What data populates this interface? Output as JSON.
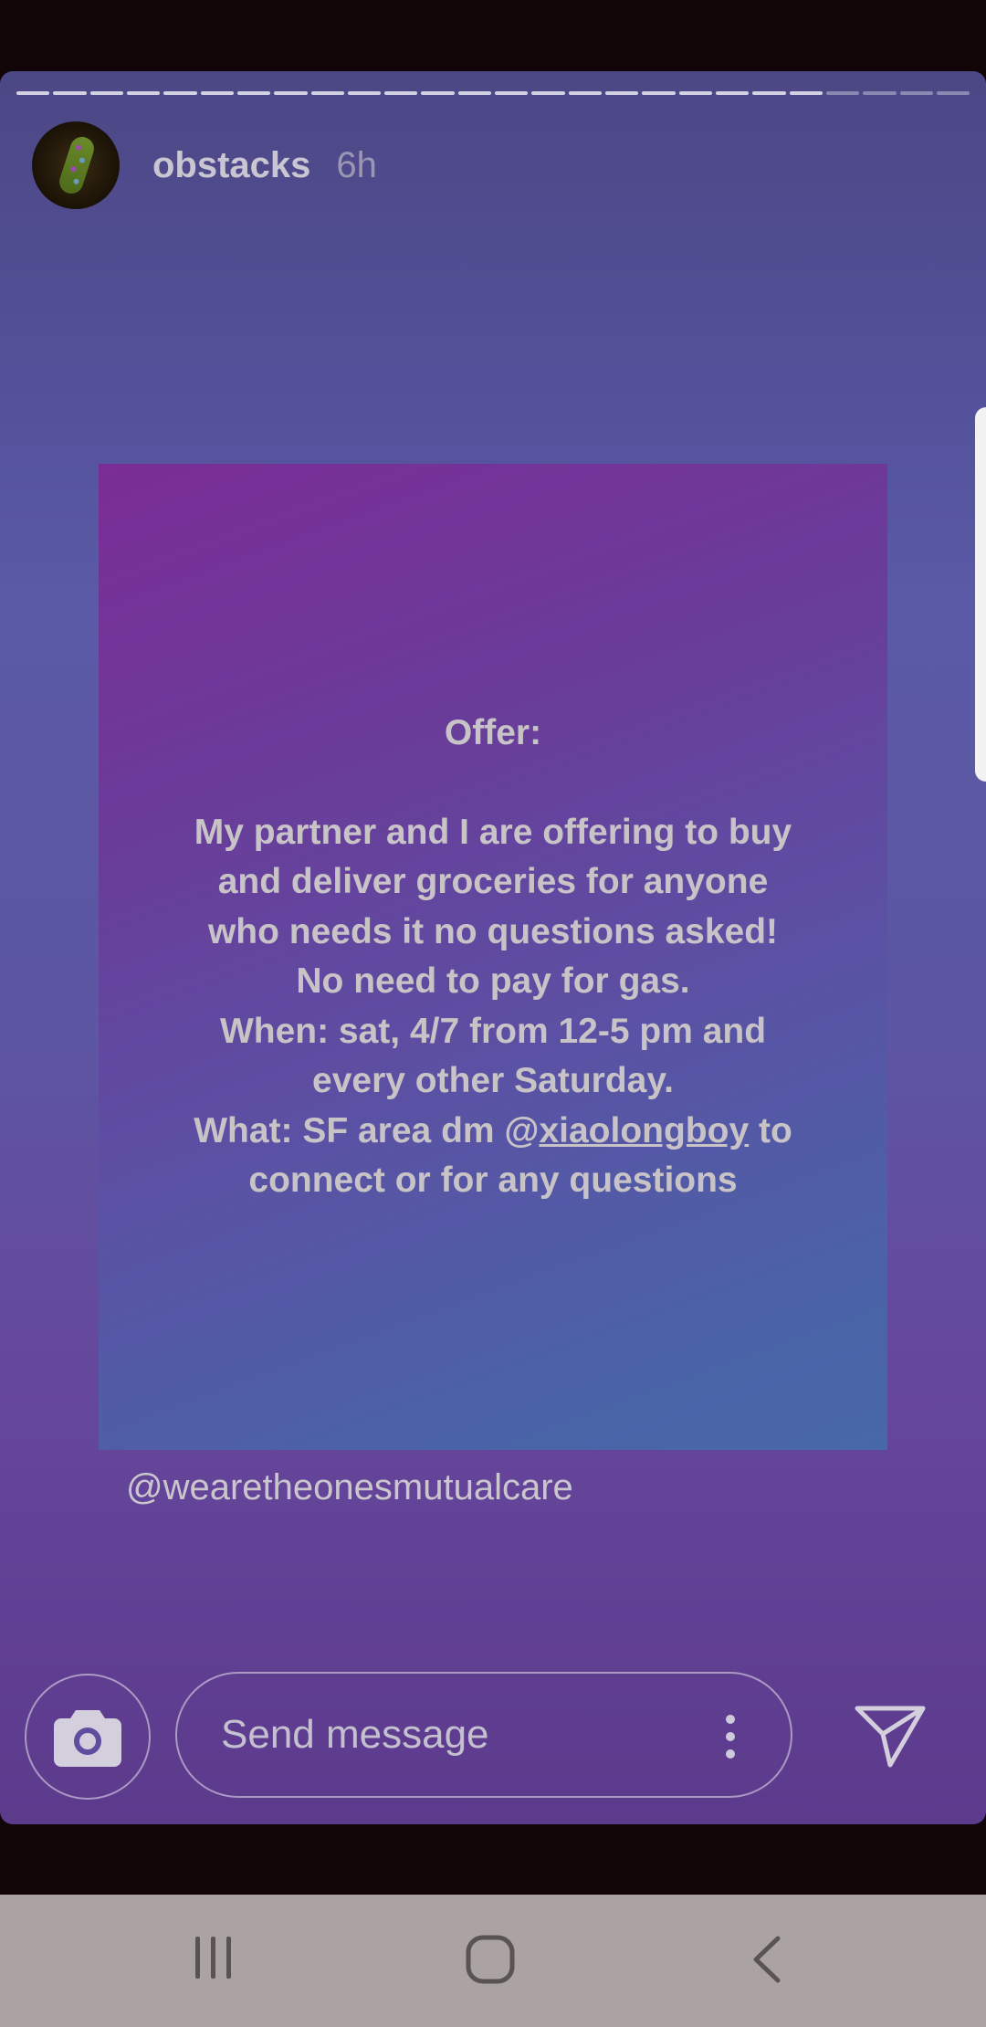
{
  "story": {
    "progress": {
      "segments": 26,
      "completed": 22
    },
    "user": {
      "username": "obstacks",
      "time": "6h"
    },
    "card": {
      "offer_title": "Offer:",
      "body_lines": [
        "My partner and I are offering to buy",
        "and deliver groceries for anyone",
        "who needs it no questions asked!",
        "No need to pay for gas.",
        "When: sat, 4/7 from 12-5 pm and",
        "every other Saturday."
      ],
      "what_prefix": "What: SF area dm @",
      "what_mention": "xiaolongboy",
      "what_suffix": " to",
      "last_line": "connect or for any questions"
    },
    "mention_tag": "@wearetheonesmutualcare"
  },
  "composer": {
    "placeholder": "Send message",
    "camera_icon": "camera-icon",
    "more_icon": "more-vertical-icon",
    "send_icon": "send-icon"
  },
  "navbar": {
    "recents_icon": "recents-icon",
    "home_icon": "home-icon",
    "back_icon": "back-icon"
  },
  "colors": {
    "story_bg": "#5a5aa6",
    "card_top": "#7a2d96",
    "card_bottom": "#4768a8",
    "text": "#c8c3c6",
    "navbar": "#aba3a3"
  }
}
